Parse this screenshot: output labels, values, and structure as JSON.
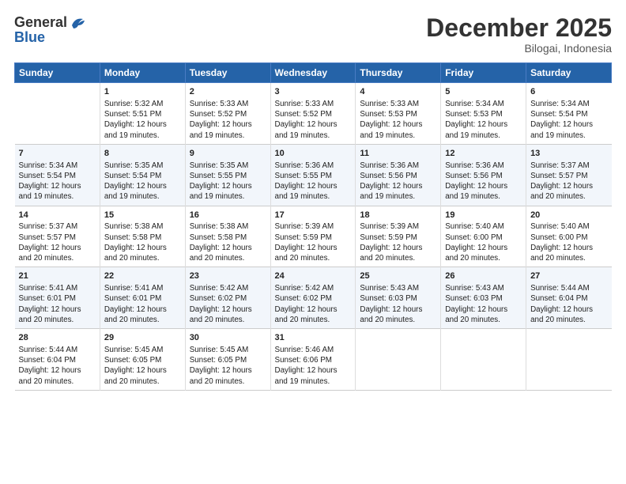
{
  "header": {
    "logo_line1": "General",
    "logo_line2": "Blue",
    "month": "December 2025",
    "location": "Bilogai, Indonesia"
  },
  "days_of_week": [
    "Sunday",
    "Monday",
    "Tuesday",
    "Wednesday",
    "Thursday",
    "Friday",
    "Saturday"
  ],
  "weeks": [
    [
      {
        "day": "",
        "text": ""
      },
      {
        "day": "1",
        "text": "Sunrise: 5:32 AM\nSunset: 5:51 PM\nDaylight: 12 hours\nand 19 minutes."
      },
      {
        "day": "2",
        "text": "Sunrise: 5:33 AM\nSunset: 5:52 PM\nDaylight: 12 hours\nand 19 minutes."
      },
      {
        "day": "3",
        "text": "Sunrise: 5:33 AM\nSunset: 5:52 PM\nDaylight: 12 hours\nand 19 minutes."
      },
      {
        "day": "4",
        "text": "Sunrise: 5:33 AM\nSunset: 5:53 PM\nDaylight: 12 hours\nand 19 minutes."
      },
      {
        "day": "5",
        "text": "Sunrise: 5:34 AM\nSunset: 5:53 PM\nDaylight: 12 hours\nand 19 minutes."
      },
      {
        "day": "6",
        "text": "Sunrise: 5:34 AM\nSunset: 5:54 PM\nDaylight: 12 hours\nand 19 minutes."
      }
    ],
    [
      {
        "day": "7",
        "text": "Sunrise: 5:34 AM\nSunset: 5:54 PM\nDaylight: 12 hours\nand 19 minutes."
      },
      {
        "day": "8",
        "text": "Sunrise: 5:35 AM\nSunset: 5:54 PM\nDaylight: 12 hours\nand 19 minutes."
      },
      {
        "day": "9",
        "text": "Sunrise: 5:35 AM\nSunset: 5:55 PM\nDaylight: 12 hours\nand 19 minutes."
      },
      {
        "day": "10",
        "text": "Sunrise: 5:36 AM\nSunset: 5:55 PM\nDaylight: 12 hours\nand 19 minutes."
      },
      {
        "day": "11",
        "text": "Sunrise: 5:36 AM\nSunset: 5:56 PM\nDaylight: 12 hours\nand 19 minutes."
      },
      {
        "day": "12",
        "text": "Sunrise: 5:36 AM\nSunset: 5:56 PM\nDaylight: 12 hours\nand 19 minutes."
      },
      {
        "day": "13",
        "text": "Sunrise: 5:37 AM\nSunset: 5:57 PM\nDaylight: 12 hours\nand 20 minutes."
      }
    ],
    [
      {
        "day": "14",
        "text": "Sunrise: 5:37 AM\nSunset: 5:57 PM\nDaylight: 12 hours\nand 20 minutes."
      },
      {
        "day": "15",
        "text": "Sunrise: 5:38 AM\nSunset: 5:58 PM\nDaylight: 12 hours\nand 20 minutes."
      },
      {
        "day": "16",
        "text": "Sunrise: 5:38 AM\nSunset: 5:58 PM\nDaylight: 12 hours\nand 20 minutes."
      },
      {
        "day": "17",
        "text": "Sunrise: 5:39 AM\nSunset: 5:59 PM\nDaylight: 12 hours\nand 20 minutes."
      },
      {
        "day": "18",
        "text": "Sunrise: 5:39 AM\nSunset: 5:59 PM\nDaylight: 12 hours\nand 20 minutes."
      },
      {
        "day": "19",
        "text": "Sunrise: 5:40 AM\nSunset: 6:00 PM\nDaylight: 12 hours\nand 20 minutes."
      },
      {
        "day": "20",
        "text": "Sunrise: 5:40 AM\nSunset: 6:00 PM\nDaylight: 12 hours\nand 20 minutes."
      }
    ],
    [
      {
        "day": "21",
        "text": "Sunrise: 5:41 AM\nSunset: 6:01 PM\nDaylight: 12 hours\nand 20 minutes."
      },
      {
        "day": "22",
        "text": "Sunrise: 5:41 AM\nSunset: 6:01 PM\nDaylight: 12 hours\nand 20 minutes."
      },
      {
        "day": "23",
        "text": "Sunrise: 5:42 AM\nSunset: 6:02 PM\nDaylight: 12 hours\nand 20 minutes."
      },
      {
        "day": "24",
        "text": "Sunrise: 5:42 AM\nSunset: 6:02 PM\nDaylight: 12 hours\nand 20 minutes."
      },
      {
        "day": "25",
        "text": "Sunrise: 5:43 AM\nSunset: 6:03 PM\nDaylight: 12 hours\nand 20 minutes."
      },
      {
        "day": "26",
        "text": "Sunrise: 5:43 AM\nSunset: 6:03 PM\nDaylight: 12 hours\nand 20 minutes."
      },
      {
        "day": "27",
        "text": "Sunrise: 5:44 AM\nSunset: 6:04 PM\nDaylight: 12 hours\nand 20 minutes."
      }
    ],
    [
      {
        "day": "28",
        "text": "Sunrise: 5:44 AM\nSunset: 6:04 PM\nDaylight: 12 hours\nand 20 minutes."
      },
      {
        "day": "29",
        "text": "Sunrise: 5:45 AM\nSunset: 6:05 PM\nDaylight: 12 hours\nand 20 minutes."
      },
      {
        "day": "30",
        "text": "Sunrise: 5:45 AM\nSunset: 6:05 PM\nDaylight: 12 hours\nand 20 minutes."
      },
      {
        "day": "31",
        "text": "Sunrise: 5:46 AM\nSunset: 6:06 PM\nDaylight: 12 hours\nand 19 minutes."
      },
      {
        "day": "",
        "text": ""
      },
      {
        "day": "",
        "text": ""
      },
      {
        "day": "",
        "text": ""
      }
    ]
  ]
}
